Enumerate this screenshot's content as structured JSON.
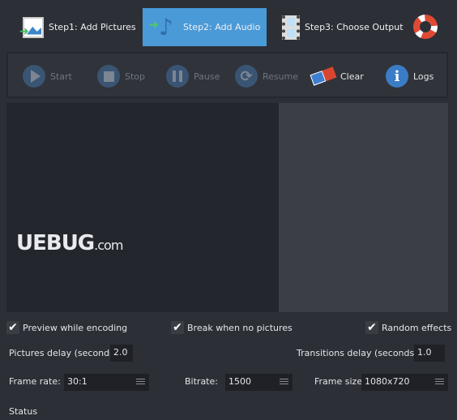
{
  "tabs": [
    {
      "label": "Step1: Add Pictures",
      "icon": "add-pictures-icon"
    },
    {
      "label": "Step2: Add Audio",
      "icon": "music-note-icon",
      "active": true
    },
    {
      "label": "Step3: Choose Output",
      "icon": "film-strip-icon"
    }
  ],
  "help_icon": "lifebuoy-icon",
  "toolbar": {
    "start": "Start",
    "stop": "Stop",
    "pause": "Pause",
    "resume": "Resume",
    "clear": "Clear",
    "logs": "Logs"
  },
  "watermark": "UEBUG.com",
  "options": {
    "preview": "Preview while encoding",
    "break": "Break when no pictures",
    "random": "Random effects"
  },
  "pictures_delay": {
    "label": "Pictures delay (seconds)",
    "value": "2.0"
  },
  "transitions_delay": {
    "label": "Transitions delay (seconds)",
    "value": "1.0"
  },
  "frame_rate": {
    "label": "Frame rate:",
    "value": "30:1"
  },
  "bitrate": {
    "label": "Bitrate:",
    "value": "1500"
  },
  "frame_size": {
    "label": "Frame size:",
    "value": "1080x720"
  },
  "status": "Status",
  "colors": {
    "accent": "#4a9ad8",
    "background": "#2c2f36"
  }
}
